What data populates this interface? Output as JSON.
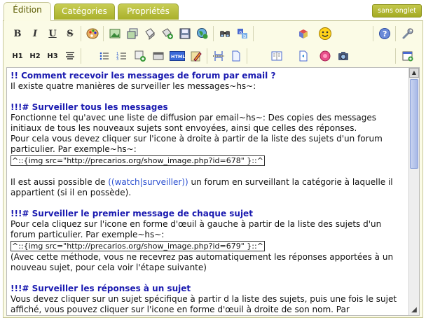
{
  "tabs": [
    {
      "label": "Édition",
      "active": true
    },
    {
      "label": "Catégories",
      "active": false
    },
    {
      "label": "Propriétés",
      "active": false
    }
  ],
  "right_button": "sans onglet",
  "toolbar1": {
    "bold": "B",
    "italic": "I",
    "underline": "U",
    "strike": "S"
  },
  "toolbar2": {
    "h1": "H1",
    "h2": "H2",
    "h3": "H3"
  },
  "content": {
    "title": "!! Comment recevoir les messages de forum par email ?",
    "intro": "Il existe quatre manières de surveiller les messages~hs~:",
    "s1_title": "!!!# Surveiller tous les messages",
    "s1_p1": "Fonctionne tel qu'avec une liste de diffusion par email~hs~: Des copies des messages initiaux de tous les nouveaux sujets sont envoyées, ainsi que celles des réponses.",
    "s1_p2": "Pour cela vous devez cliquer sur l'icone à droite à partir de la liste des sujets d'un forum particulier. Par exemple~hs~:",
    "s1_code": "^::{img src=\"http://precarios.org/show_image.php?id=678\" }::^",
    "s1_p3_before": "Il est aussi possible de ",
    "s1_p3_link": "((watch|surveiller))",
    "s1_p3_after": " un forum en surveillant la catégorie à laquelle il appartient (si il en possède).",
    "s2_title": "!!!# Surveiller le premier message de chaque sujet",
    "s2_p1": "Pour cela cliquez sur l'icone en forme d'œuil à gauche à partir de la liste des sujets d'un forum particulier. Par exemple~hs~:",
    "s2_code": "^::{img src=\"http://precarios.org/show_image.php?id=679\" }::^",
    "s2_p2": "(Avec cette méthode, vous ne recevrez pas automatiquement les réponses apportées à un nouveau sujet, pour cela voir l'étape suivante)",
    "s3_title": "!!!# Surveiller les réponses à un sujet",
    "s3_p1": "Vous devez cliquer sur un sujet spécifique à partir d la liste des sujets, puis une fois le sujet affiché, vous pouvez cliquer sur l'icone en forme d'œuil à droite de son nom. Par"
  },
  "colors": {
    "tab_green": "#b5bb38",
    "editor_bg": "#fbfbe6",
    "heading_blue": "#1a1ab0",
    "link_blue": "#2a4fd0"
  },
  "icons": {
    "toolbar1": [
      "bold-icon",
      "italic-icon",
      "underline-icon",
      "strikethrough-icon",
      "palette-icon",
      "image-icon",
      "gallery-icon",
      "file-icon",
      "attachment-icon",
      "floppy-icon",
      "globe-icon",
      "binoculars-icon",
      "replace-icon",
      "box-icon",
      "smiley-icon",
      "help-icon",
      "wrench-icon"
    ],
    "toolbar2": [
      "h1-icon",
      "h2-icon",
      "h3-icon",
      "align-center-icon",
      "bullet-list-icon",
      "numbered-list-icon",
      "add-plugin-icon",
      "table-icon",
      "html-icon",
      "pencil-icon",
      "page-break-icon",
      "page-icon",
      "columns-icon",
      "preview-icon",
      "record-icon",
      "camera-icon",
      "add-window-icon"
    ]
  }
}
